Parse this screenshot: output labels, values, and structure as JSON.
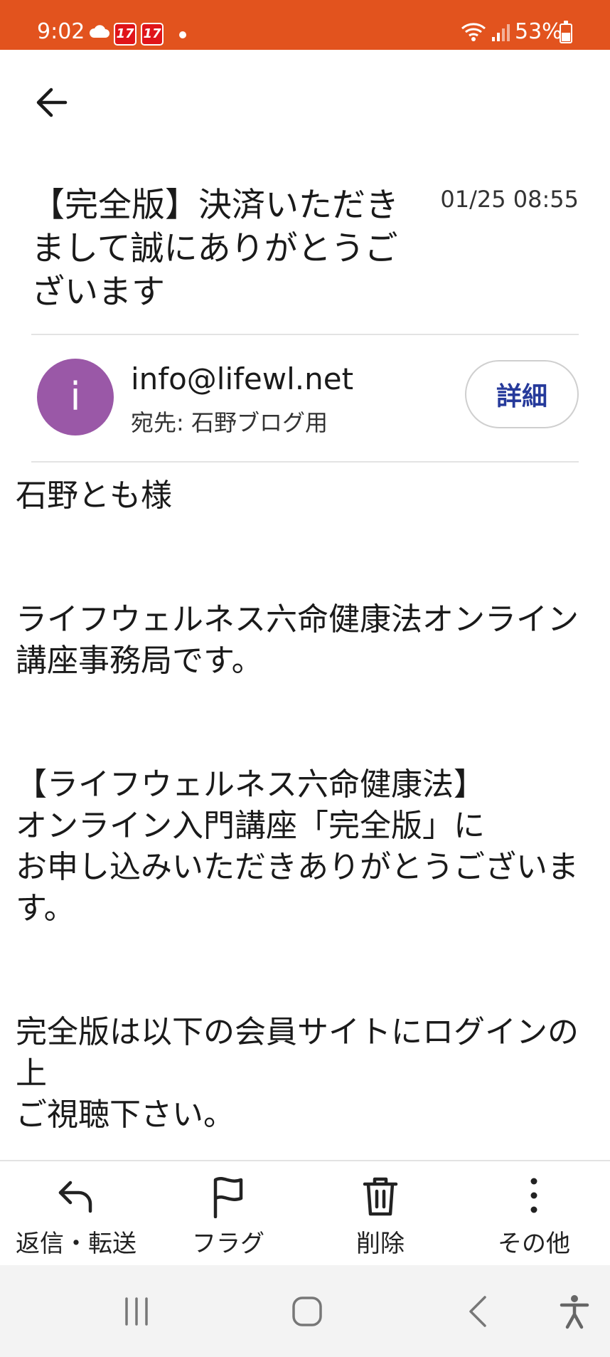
{
  "status_bar": {
    "time": "9:02",
    "badges": [
      "17",
      "17"
    ],
    "battery": "53%",
    "color": "#e2531e"
  },
  "header": {
    "back_icon": "arrow-left-icon"
  },
  "email": {
    "subject": "【完全版】決済いただきまして誠にありがとうございます",
    "date": "01/25 08:55",
    "sender": {
      "avatar_letter": "i",
      "avatar_color": "#9a58a7",
      "address": "info@lifewl.net",
      "to": "宛先: 石野ブログ用"
    },
    "details_label": "詳細",
    "body": [
      "石野とも様",
      "",
      "",
      "ライフウェルネス六命健康法オンライン講座事務局です。",
      "",
      "",
      "【ライフウェルネス六命健康法】",
      "オンライン入門講座「完全版」に",
      "お申し込みいただきありがとうございます。",
      "",
      "",
      "完全版は以下の会員サイトにログインの上",
      "ご視聴下さい。"
    ]
  },
  "actions": [
    {
      "label": "返信・転送",
      "icon": "reply-icon"
    },
    {
      "label": "フラグ",
      "icon": "flag-icon"
    },
    {
      "label": "削除",
      "icon": "trash-icon"
    },
    {
      "label": "その他",
      "icon": "more-vertical-icon"
    }
  ],
  "nav": [
    {
      "icon": "recent-apps-icon"
    },
    {
      "icon": "home-icon"
    },
    {
      "icon": "back-icon"
    },
    {
      "icon": "accessibility-icon"
    }
  ]
}
